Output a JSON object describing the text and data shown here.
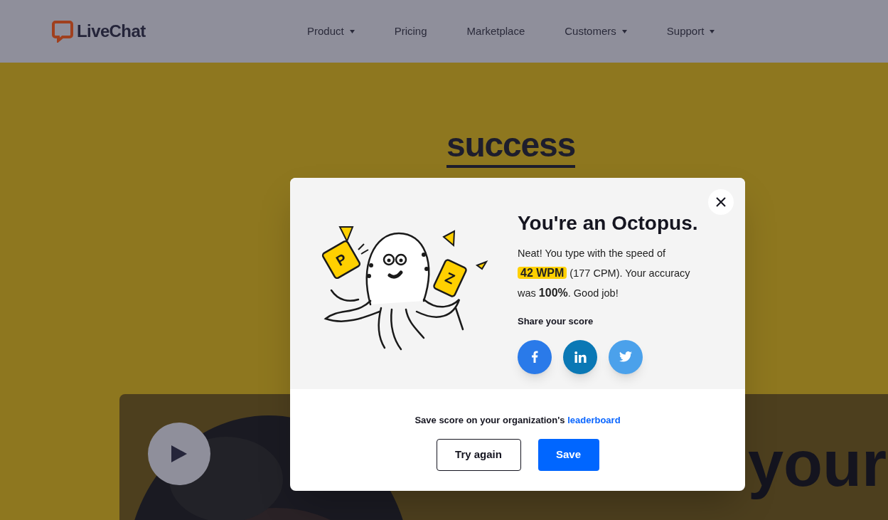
{
  "header": {
    "logo": "LiveChat",
    "nav": [
      {
        "label": "Product",
        "dropdown": true
      },
      {
        "label": "Pricing",
        "dropdown": false
      },
      {
        "label": "Marketplace",
        "dropdown": false
      },
      {
        "label": "Customers",
        "dropdown": true
      },
      {
        "label": "Support",
        "dropdown": true
      }
    ]
  },
  "hero": {
    "logo": "success",
    "headline": "your"
  },
  "modal": {
    "illustration": {
      "letters": [
        "P",
        "Z"
      ]
    },
    "title": "You're an Octopus.",
    "result": [
      {
        "kind": "plain",
        "text": "Neat! You type with the speed of "
      },
      {
        "kind": "highlight",
        "text": "42 WPM"
      },
      {
        "kind": "plain",
        "text": " (177 CPM). Your accuracy was "
      },
      {
        "kind": "bold",
        "text": "100%"
      },
      {
        "kind": "plain",
        "text": ". Good job!"
      }
    ],
    "share_label": "Share your score",
    "share": [
      {
        "kind": "facebook",
        "color": "#2a7ae9"
      },
      {
        "kind": "linkedin",
        "color": "#0a78b5"
      },
      {
        "kind": "twitter",
        "color": "#4ba1eb"
      }
    ],
    "save_note": "Save score on your organization's ",
    "save_link": "leaderboard",
    "buttons": [
      {
        "label": "Try again",
        "kind": "secondary"
      },
      {
        "label": "Save",
        "kind": "primary"
      }
    ]
  }
}
